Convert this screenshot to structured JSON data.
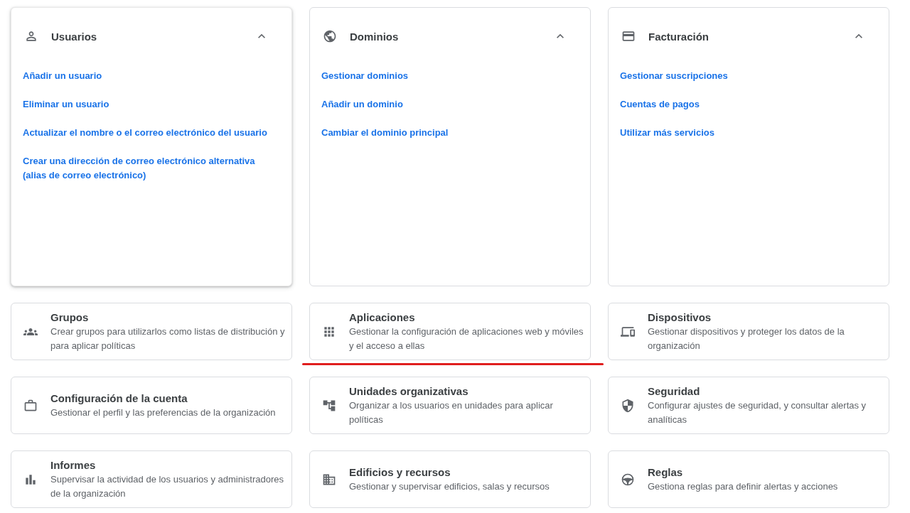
{
  "sections": [
    {
      "title": "Usuarios",
      "expanded": true,
      "elevated": true,
      "links": [
        "Añadir un usuario",
        "Eliminar un usuario",
        "Actualizar el nombre o el correo electrónico del usuario",
        "Crear una dirección de correo electrónico alternativa (alias de correo electrónico)"
      ]
    },
    {
      "title": "Dominios",
      "expanded": true,
      "elevated": false,
      "links": [
        "Gestionar dominios",
        "Añadir un dominio",
        "Cambiar el dominio principal"
      ]
    },
    {
      "title": "Facturación",
      "expanded": true,
      "elevated": false,
      "links": [
        "Gestionar suscripciones",
        "Cuentas de pagos",
        "Utilizar más servicios"
      ]
    }
  ],
  "tiles": [
    {
      "title": "Grupos",
      "description": "Crear grupos para utilizarlos como listas de distribución y para aplicar políticas",
      "highlighted": false
    },
    {
      "title": "Aplicaciones",
      "description": "Gestionar la configuración de aplicaciones web y móviles y el acceso a ellas",
      "highlighted": true
    },
    {
      "title": "Dispositivos",
      "description": "Gestionar dispositivos y proteger los datos de la organización",
      "highlighted": false
    },
    {
      "title": "Configuración de la cuenta",
      "description": "Gestionar el perfil y las preferencias de la organización",
      "highlighted": false
    },
    {
      "title": "Unidades organizativas",
      "description": "Organizar a los usuarios en unidades para aplicar políticas",
      "highlighted": false
    },
    {
      "title": "Seguridad",
      "description": "Configurar ajustes de seguridad, y consultar alertas y analíticas",
      "highlighted": false
    },
    {
      "title": "Informes",
      "description": "Supervisar la actividad de los usuarios y administradores de la organización",
      "highlighted": false
    },
    {
      "title": "Edificios y recursos",
      "description": "Gestionar y supervisar edificios, salas y recursos",
      "highlighted": false
    },
    {
      "title": "Reglas",
      "description": "Gestiona reglas para definir alertas y acciones",
      "highlighted": false
    }
  ]
}
